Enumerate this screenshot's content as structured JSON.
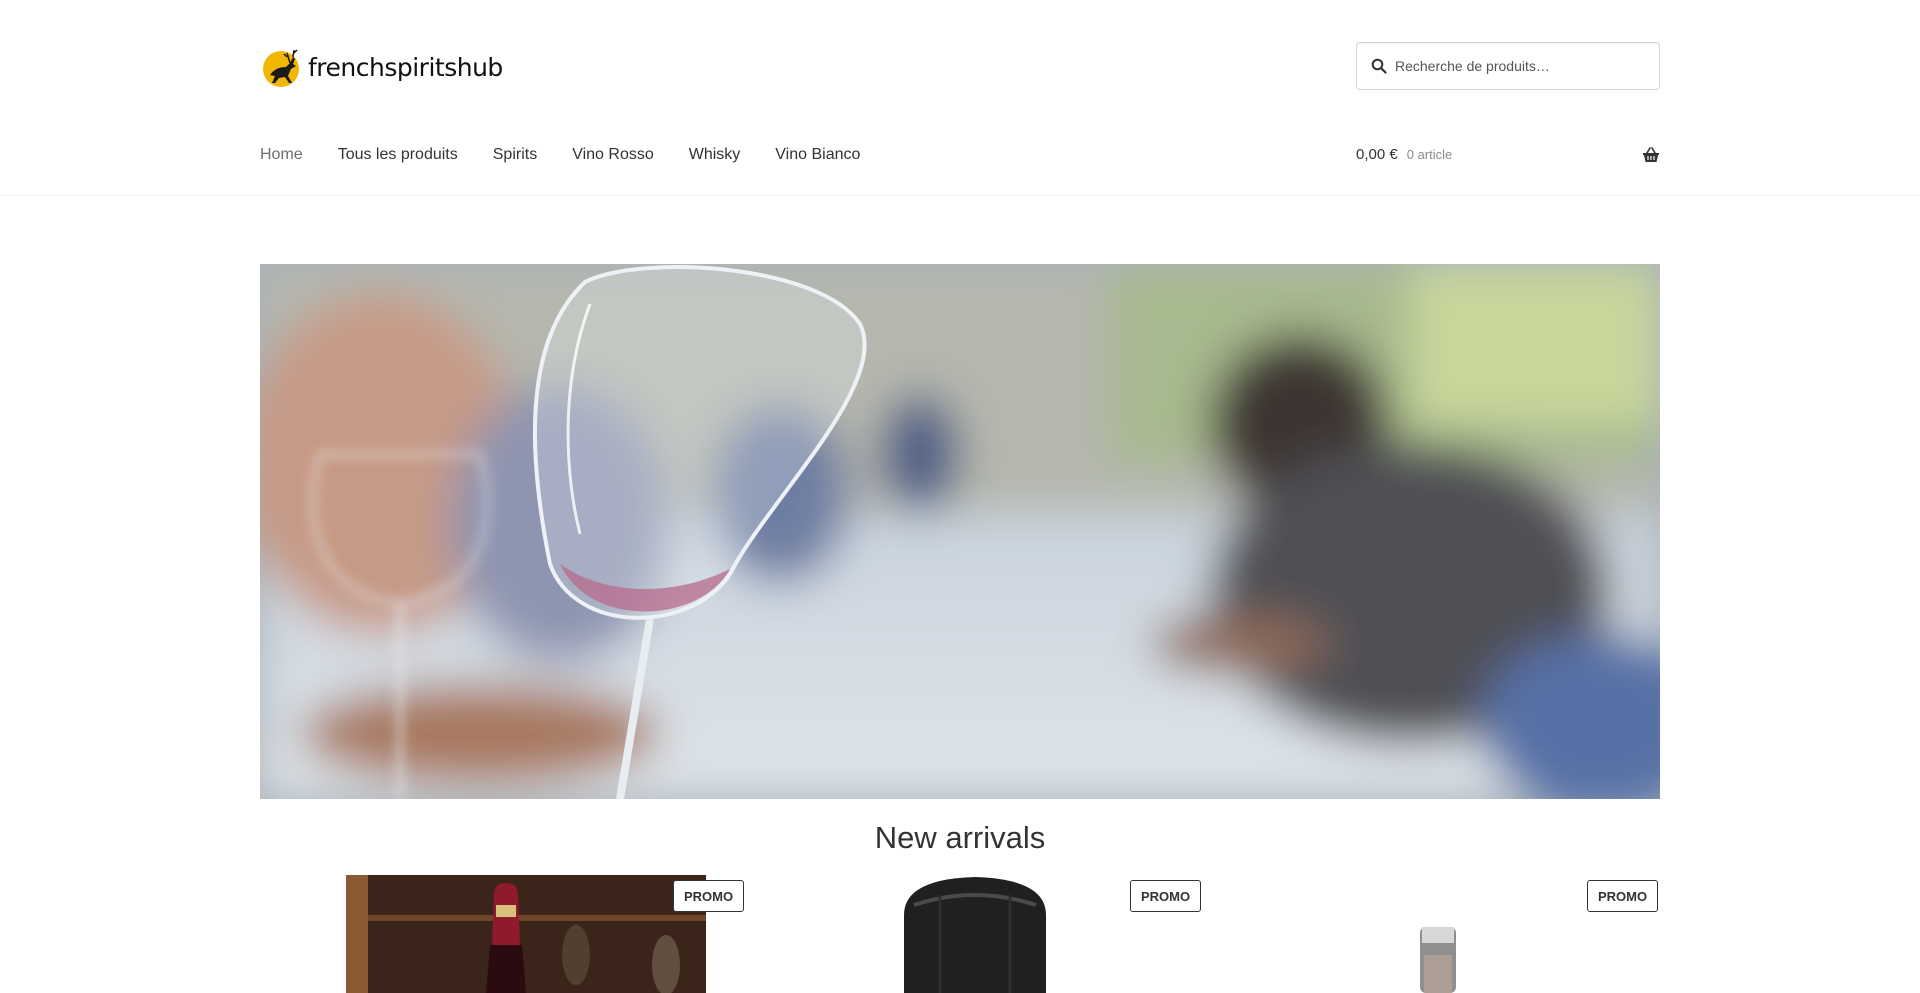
{
  "brand": {
    "name": "frenchspiritshub"
  },
  "search": {
    "placeholder": "Recherche de produits…"
  },
  "nav": {
    "items": [
      {
        "label": "Home",
        "current": true
      },
      {
        "label": "Tous les produits"
      },
      {
        "label": "Spirits"
      },
      {
        "label": "Vino Rosso"
      },
      {
        "label": "Whisky"
      },
      {
        "label": "Vino Bianco"
      }
    ]
  },
  "cart": {
    "amount": "0,00 €",
    "count": "0 article"
  },
  "section": {
    "title": "New arrivals"
  },
  "products": [
    {
      "badge": "PROMO"
    },
    {
      "badge": "PROMO"
    },
    {
      "badge": "PROMO"
    }
  ],
  "colors": {
    "text": "#333333",
    "muted": "#6d6d6d",
    "accent_logo": "#f2b705"
  }
}
